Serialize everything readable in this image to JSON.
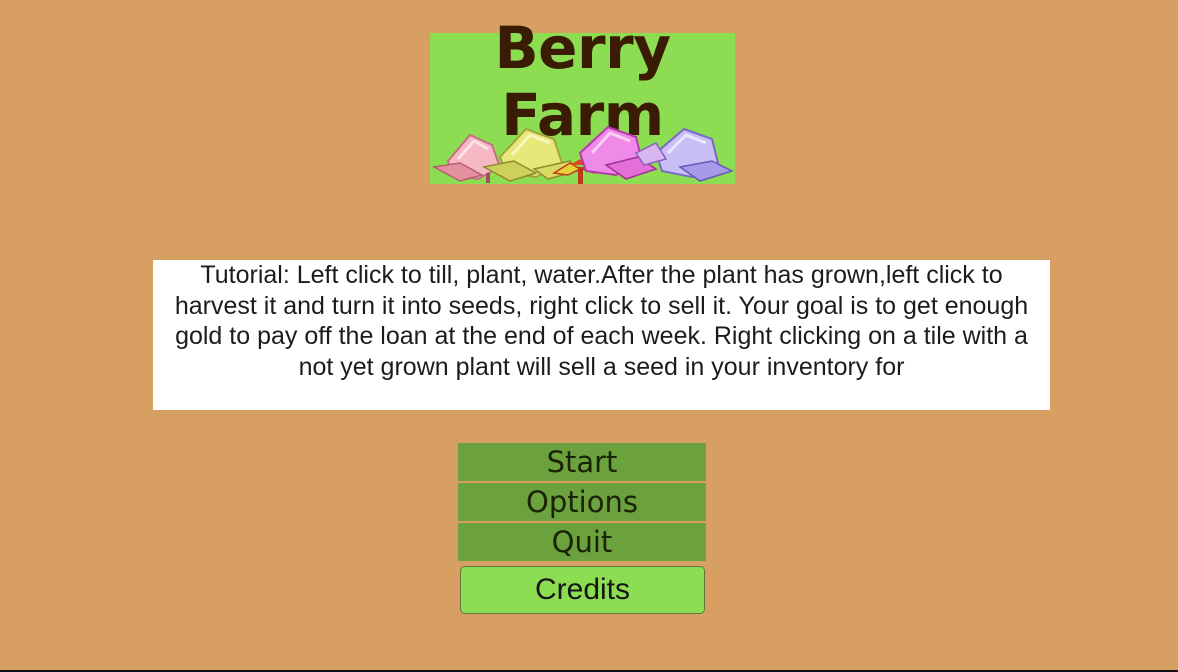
{
  "title": {
    "line1": "Berry",
    "line2": "Farm"
  },
  "tutorial": {
    "text": "Tutorial: Left click to till, plant, water.After the plant has grown,left click to harvest it and turn it into seeds, right click to sell it. Your goal is to get enough gold to pay off the loan at the end of each week. Right clicking on a tile with a not yet grown plant will sell a seed in your inventory for"
  },
  "menu": {
    "start": "Start",
    "options": "Options",
    "quit": "Quit",
    "credits": "Credits"
  },
  "colors": {
    "background": "#d89f63",
    "title_panel": "#8ddd52",
    "button": "#6ba23d",
    "credits_button": "#8ddd52",
    "title_text": "#3a1c05"
  },
  "icons": [
    "pink-berry-icon",
    "yellow-berry-icon",
    "red-sprout-icon",
    "magenta-berry-icon",
    "purple-berry-icon"
  ]
}
